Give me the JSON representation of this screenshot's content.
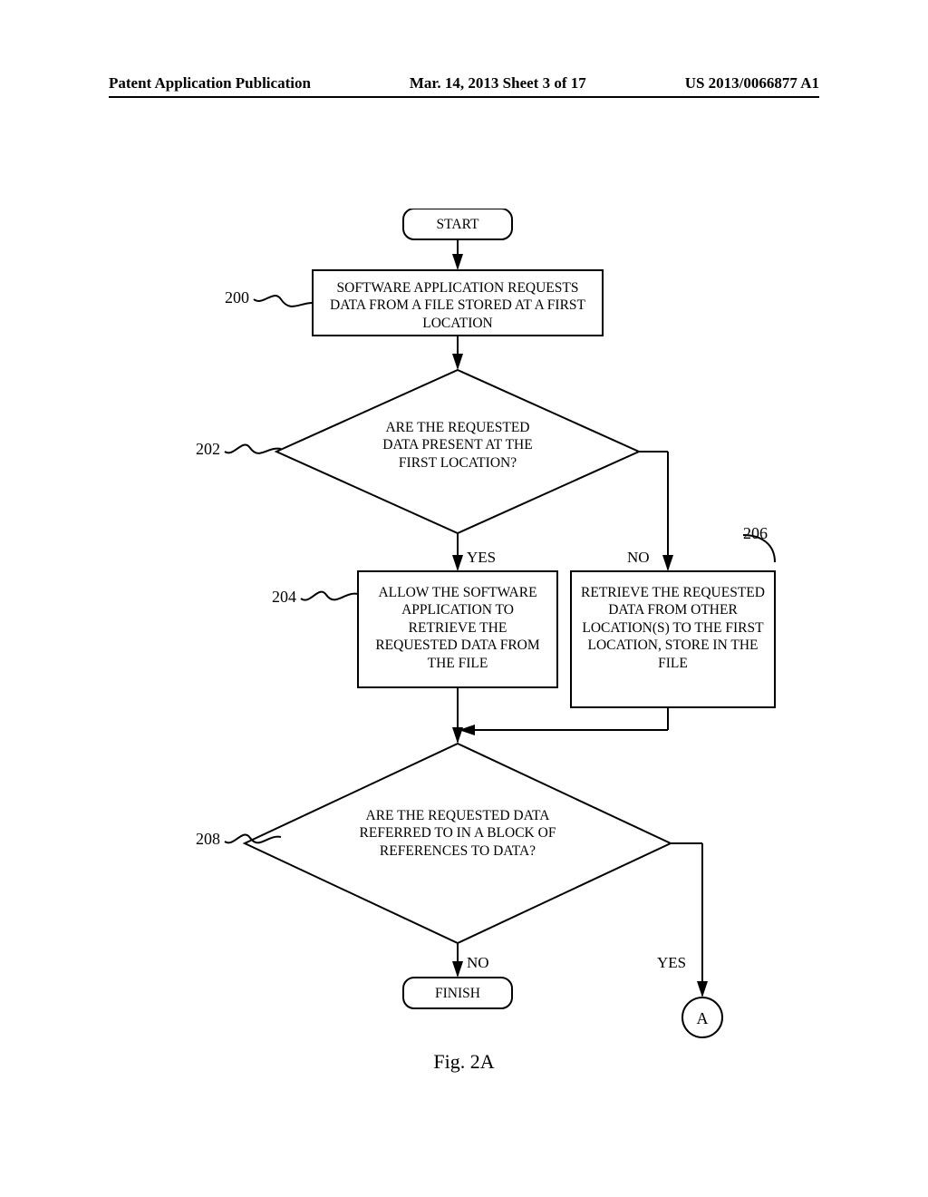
{
  "header": {
    "left": "Patent Application Publication",
    "center": "Mar. 14, 2013  Sheet 3 of 17",
    "right": "US 2013/0066877 A1"
  },
  "refs": {
    "r200": "200",
    "r202": "202",
    "r204": "204",
    "r206": "206",
    "r208": "208"
  },
  "nodes": {
    "start": "START",
    "n200": "SOFTWARE APPLICATION REQUESTS DATA FROM A FILE STORED AT A FIRST LOCATION",
    "n202": "ARE THE REQUESTED DATA PRESENT AT THE FIRST LOCATION?",
    "n204": "ALLOW THE SOFTWARE APPLICATION TO RETRIEVE THE REQUESTED DATA FROM THE FILE",
    "n206": "RETRIEVE THE REQUESTED DATA FROM OTHER LOCATION(S) TO THE FIRST LOCATION, STORE IN THE FILE",
    "n208": "ARE THE REQUESTED DATA REFERRED TO IN A BLOCK OF REFERENCES TO DATA?",
    "finish": "FINISH",
    "connA": "A"
  },
  "edges": {
    "yes1": "YES",
    "no1": "NO",
    "yes2": "YES",
    "no2": "NO"
  },
  "caption": "Fig. 2A"
}
